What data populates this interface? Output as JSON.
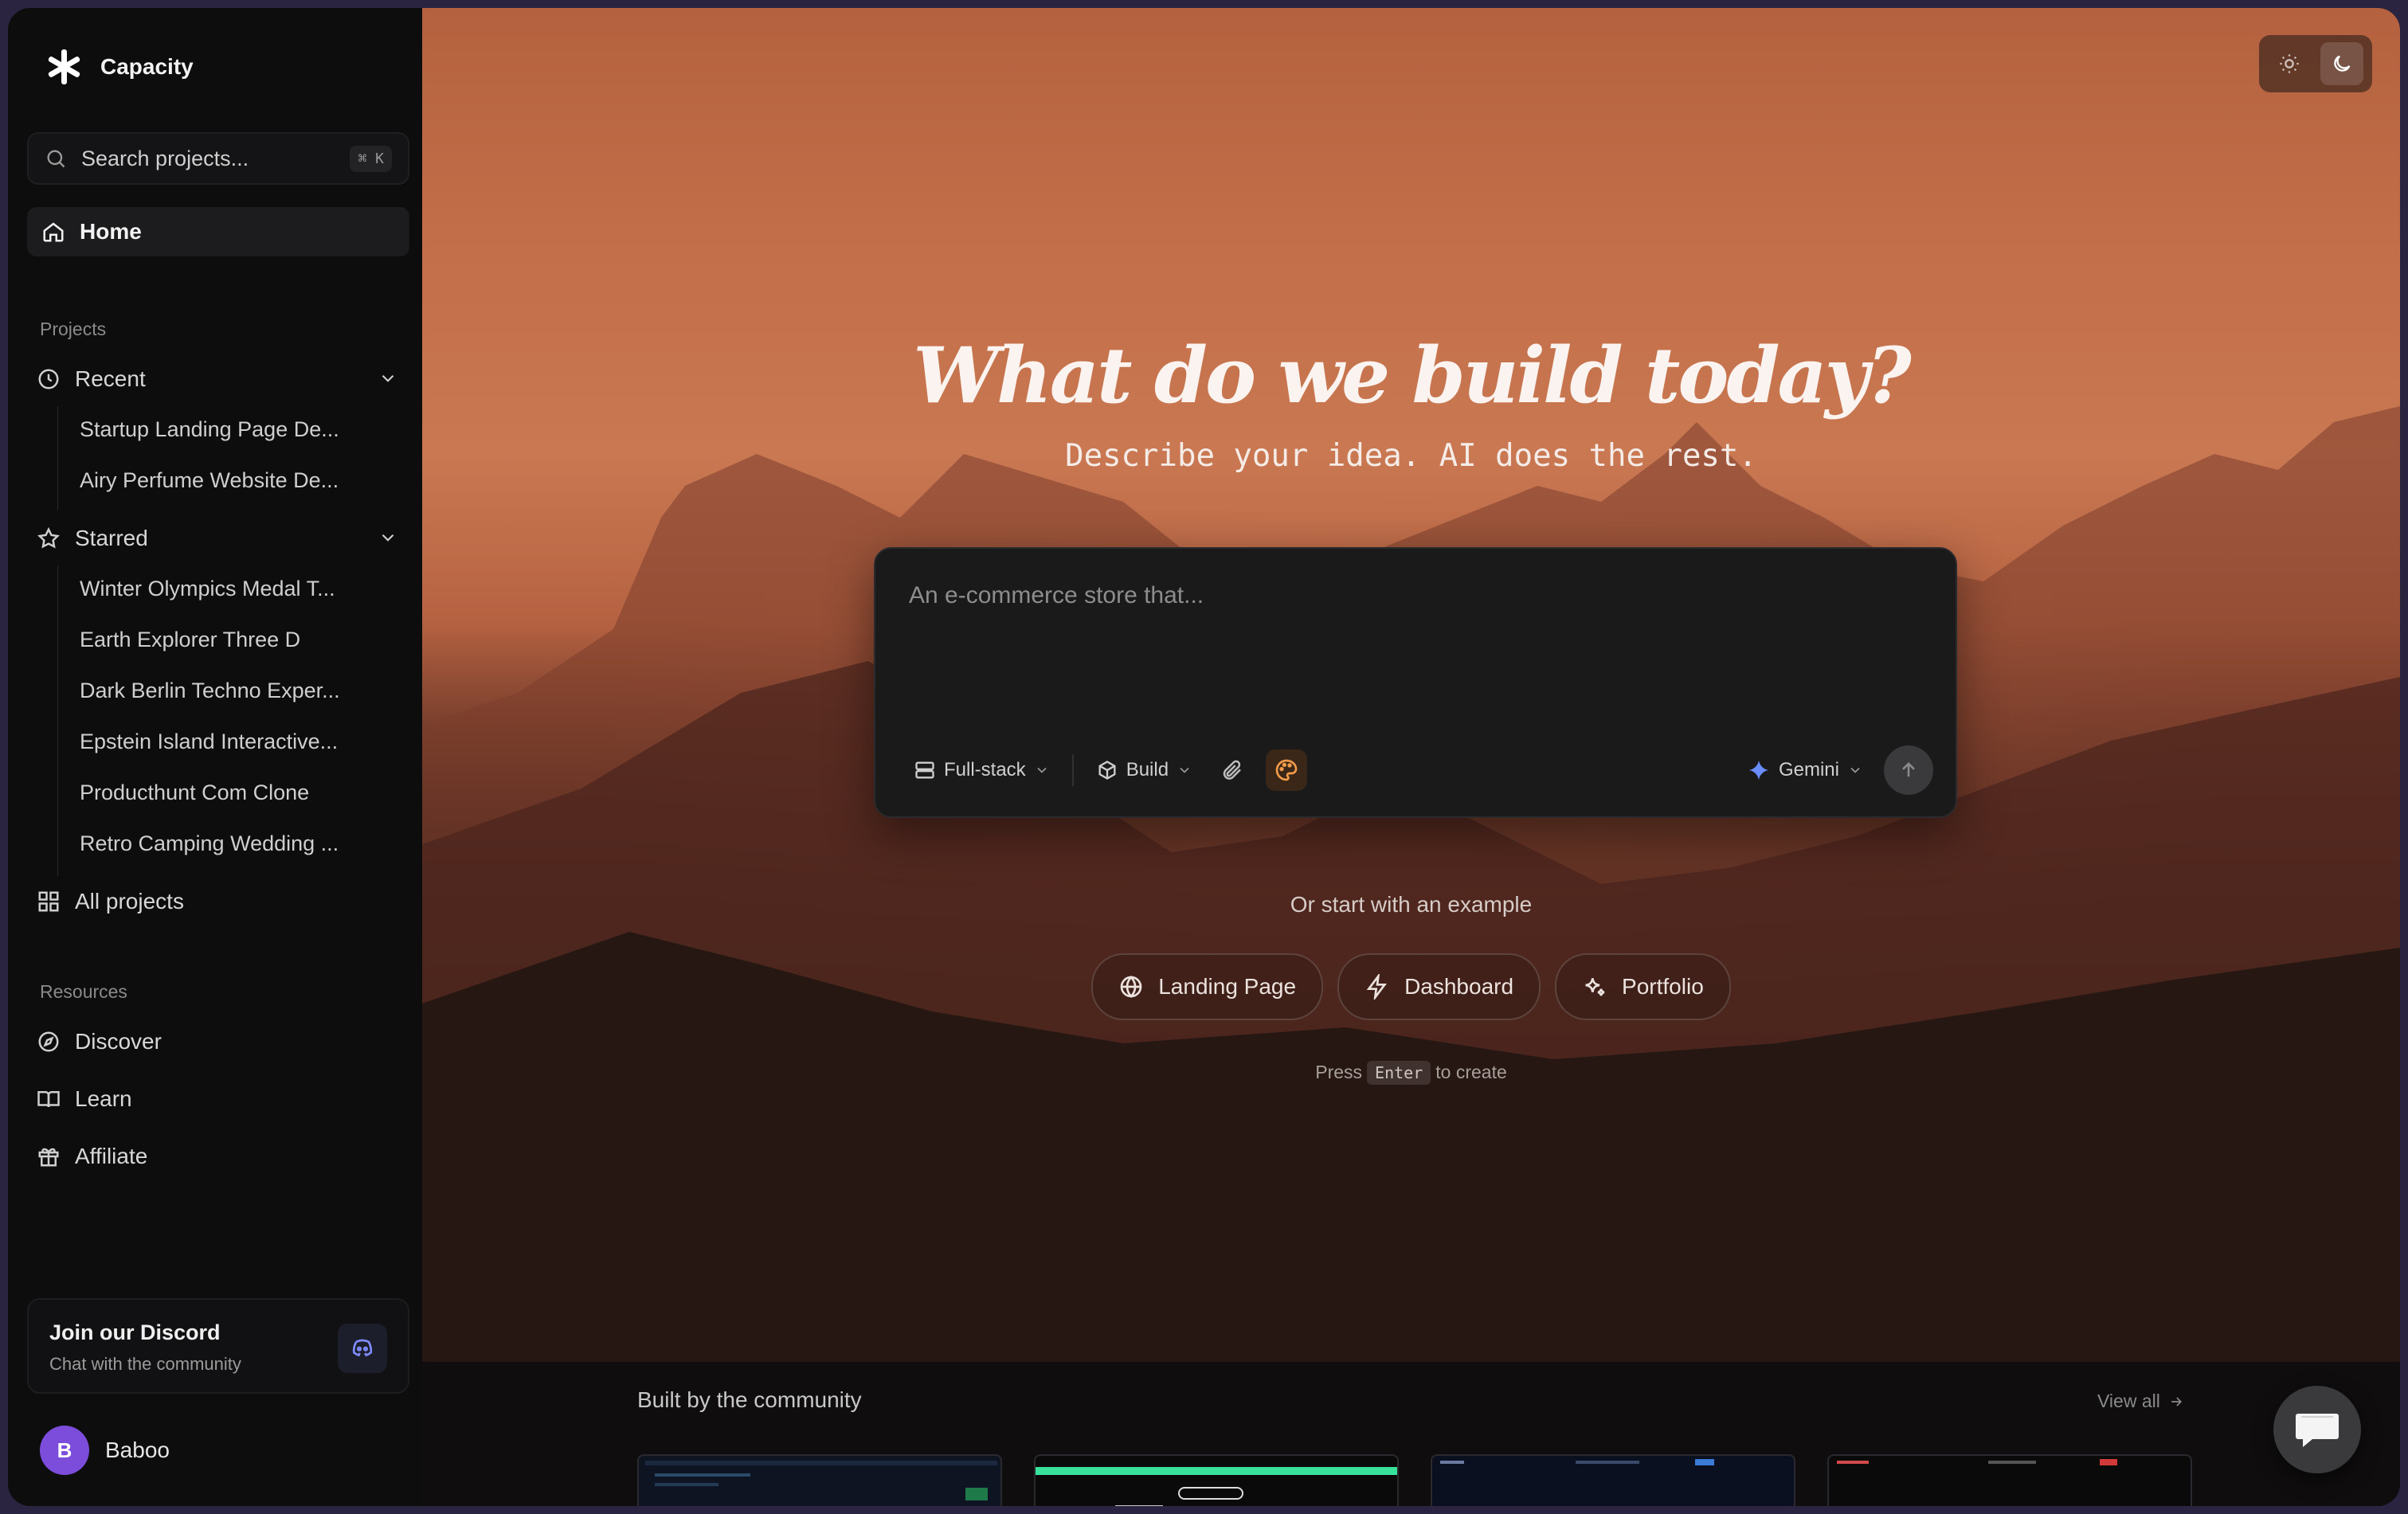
{
  "app": {
    "name": "Capacity"
  },
  "search": {
    "placeholder": "Search projects...",
    "shortcut": "⌘ K"
  },
  "nav": {
    "home": "Home"
  },
  "projects": {
    "label": "Projects",
    "recent": {
      "label": "Recent",
      "items": [
        "Startup Landing Page De...",
        "Airy Perfume Website De..."
      ]
    },
    "starred": {
      "label": "Starred",
      "items": [
        "Winter Olympics Medal T...",
        "Earth Explorer Three D",
        "Dark Berlin Techno Exper...",
        "Epstein Island Interactive...",
        "Producthunt Com Clone",
        "Retro Camping Wedding ..."
      ]
    },
    "all": "All projects"
  },
  "resources": {
    "label": "Resources",
    "items": [
      "Discover",
      "Learn",
      "Affiliate"
    ]
  },
  "discord": {
    "title": "Join our Discord",
    "subtitle": "Chat with the community"
  },
  "user": {
    "initial": "B",
    "name": "Baboo"
  },
  "hero": {
    "title": "What do we build today?",
    "subtitle": "Describe your idea. AI does the rest."
  },
  "prompt": {
    "placeholder": "An e-commerce store that...",
    "stack": "Full-stack",
    "mode": "Build",
    "model": "Gemini"
  },
  "examples": {
    "label": "Or start with an example",
    "items": [
      "Landing Page",
      "Dashboard",
      "Portfolio"
    ],
    "press_prefix": "Press",
    "press_key": "Enter",
    "press_suffix": "to create"
  },
  "community": {
    "title": "Built by the community",
    "view_all": "View all"
  },
  "colors": {
    "accent_orange": "#f29a4a",
    "gemini_blue": "#6b8cff",
    "avatar_purple": "#7c4ddb"
  }
}
